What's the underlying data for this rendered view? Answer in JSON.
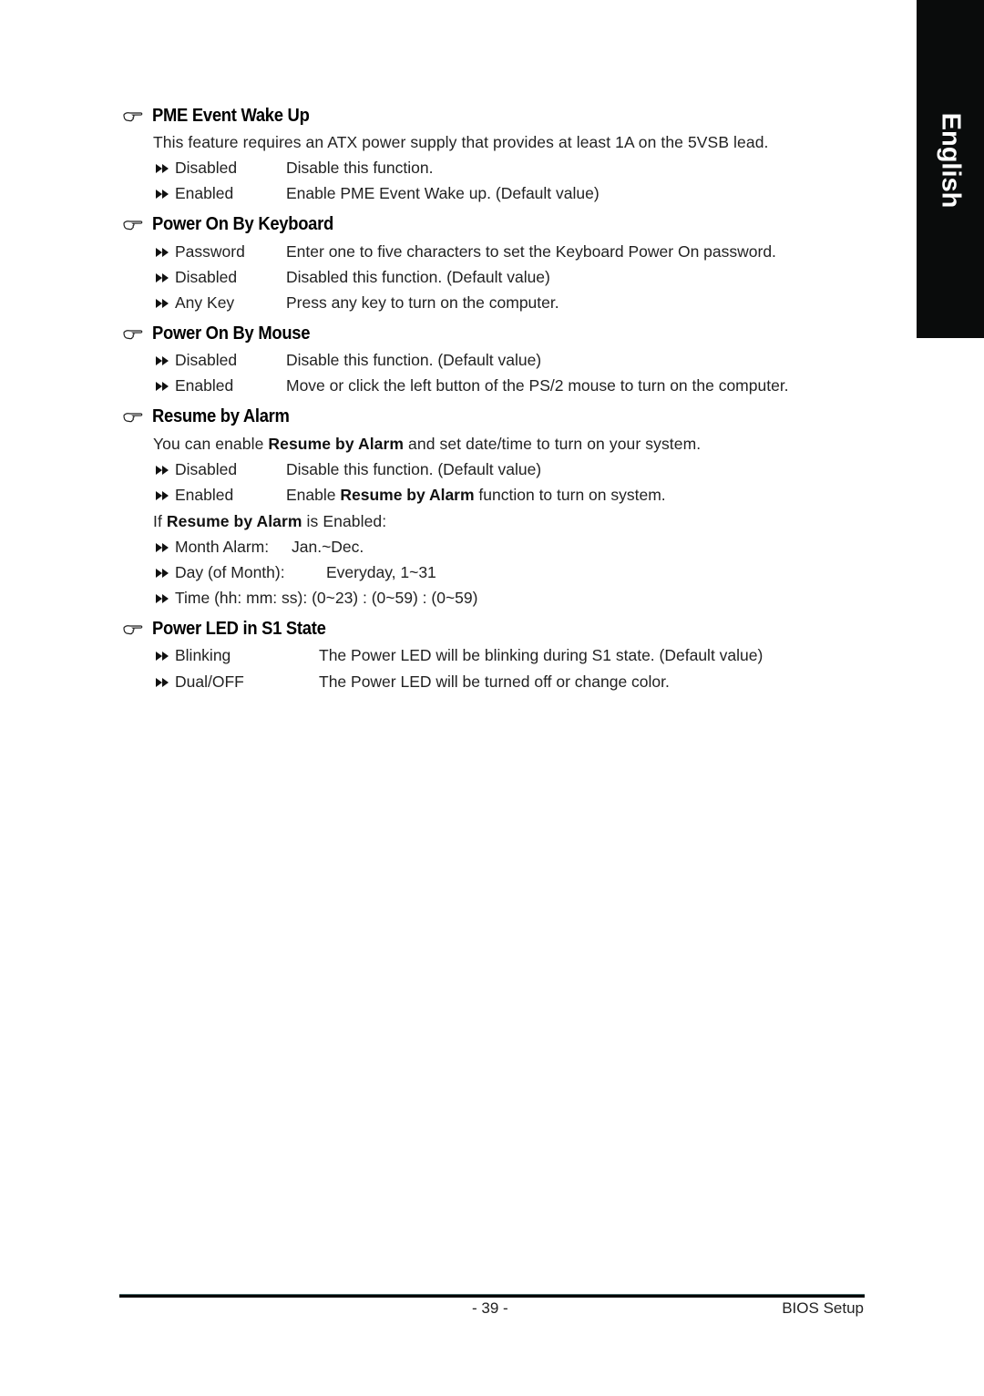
{
  "language_tab": "English",
  "sections": [
    {
      "title": "PME Event Wake Up",
      "intro": "This feature requires an ATX power supply that provides at least 1A on the 5VSB lead.",
      "options": [
        {
          "label": "Disabled",
          "desc": "Disable this function."
        },
        {
          "label": "Enabled",
          "desc": "Enable PME Event Wake up. (Default value)"
        }
      ]
    },
    {
      "title": "Power On By Keyboard",
      "options": [
        {
          "label": "Password",
          "desc": "Enter one to five characters to set the Keyboard Power On password."
        },
        {
          "label": "Disabled",
          "desc": "Disabled this function. (Default value)"
        },
        {
          "label": "Any Key",
          "desc": "Press any key to turn on the computer."
        }
      ]
    },
    {
      "title": "Power On By Mouse",
      "options": [
        {
          "label": "Disabled",
          "desc": "Disable this function. (Default value)"
        },
        {
          "label": "Enabled",
          "desc": "Move or click the left button of the PS/2 mouse to turn on the computer."
        }
      ]
    },
    {
      "title": "Resume by Alarm",
      "intro_parts": {
        "before": "You can enable ",
        "bold": "Resume by Alarm",
        "after": " and set date/time to turn on your system."
      },
      "options": [
        {
          "label": "Disabled",
          "desc": "Disable this function. (Default value)"
        },
        {
          "label": "Enabled",
          "desc_before": "Enable ",
          "desc_bold": "Resume by Alarm",
          "desc_after": " function to turn on system."
        }
      ],
      "condition": {
        "before": "If ",
        "bold": "Resume by Alarm",
        "after": " is Enabled:"
      },
      "alarm_fields": [
        {
          "label": "Month Alarm:",
          "value": "Jan.~Dec."
        },
        {
          "label": "Day (of Month):",
          "value": "Everyday, 1~31"
        },
        {
          "label": "Time (hh: mm: ss):",
          "value": "(0~23) : (0~59) : (0~59)"
        }
      ]
    },
    {
      "title": "Power LED in S1 State",
      "options": [
        {
          "label": "Blinking",
          "desc": "The Power LED will be blinking during S1 state. (Default value)"
        },
        {
          "label": "Dual/OFF",
          "desc": "The Power LED will be turned off or change color."
        }
      ]
    }
  ],
  "footer": {
    "page_number": "- 39 -",
    "chapter": "BIOS Setup"
  }
}
